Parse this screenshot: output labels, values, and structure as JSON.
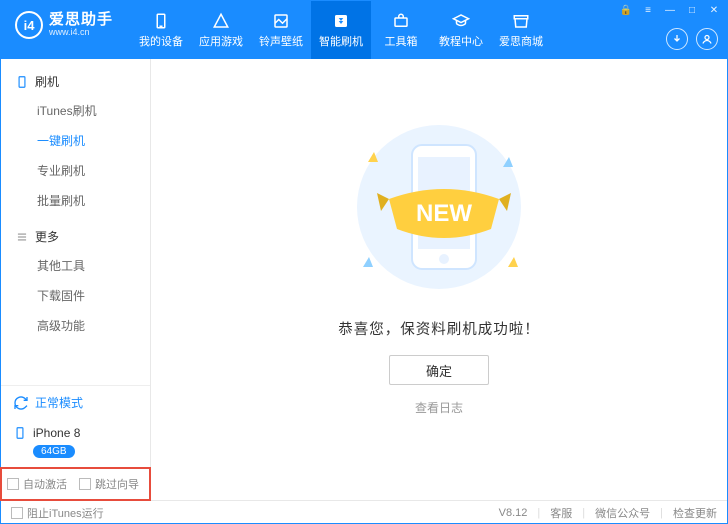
{
  "brand": {
    "name": "爱思助手",
    "site": "www.i4.cn",
    "logo_letters": "i4"
  },
  "nav": {
    "items": [
      {
        "label": "我的设备"
      },
      {
        "label": "应用游戏"
      },
      {
        "label": "铃声壁纸"
      },
      {
        "label": "智能刷机"
      },
      {
        "label": "工具箱"
      },
      {
        "label": "教程中心"
      },
      {
        "label": "爱思商城"
      }
    ],
    "active_index": 3
  },
  "sidebar": {
    "sections": [
      {
        "title": "刷机",
        "items": [
          "iTunes刷机",
          "一键刷机",
          "专业刷机",
          "批量刷机"
        ],
        "active_index": 1
      },
      {
        "title": "更多",
        "items": [
          "其他工具",
          "下载固件",
          "高级功能"
        ],
        "active_index": -1
      }
    ],
    "mode": "正常模式",
    "device": {
      "name": "iPhone 8",
      "storage": "64GB"
    },
    "options": {
      "auto_activate": "自动激活",
      "skip_wizard": "跳过向导"
    }
  },
  "main": {
    "banner_text": "NEW",
    "message": "恭喜您，保资料刷机成功啦！",
    "ok": "确定",
    "view_log": "查看日志"
  },
  "footer": {
    "block_itunes": "阻止iTunes运行",
    "version": "V8.12",
    "service": "客服",
    "wechat": "微信公众号",
    "update": "检查更新"
  }
}
